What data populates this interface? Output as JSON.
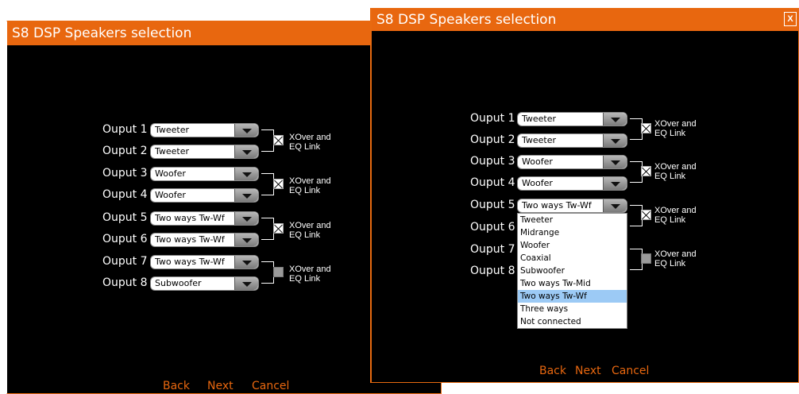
{
  "left_window": {
    "title": "S8 DSP Speakers selection",
    "outputs": [
      {
        "label": "Ouput 1",
        "value": "Tweeter"
      },
      {
        "label": "Ouput 2",
        "value": "Tweeter"
      },
      {
        "label": "Ouput 3",
        "value": "Woofer"
      },
      {
        "label": "Ouput 4",
        "value": "Woofer"
      },
      {
        "label": "Ouput 5",
        "value": "Two ways Tw-Wf"
      },
      {
        "label": "Ouput 6",
        "value": "Two ways Tw-Wf"
      },
      {
        "label": "Ouput 7",
        "value": "Two ways Tw-Wf"
      },
      {
        "label": "Ouput 8",
        "value": "Subwoofer"
      }
    ],
    "links": [
      {
        "line1": "XOver and",
        "line2": "EQ Link",
        "state": "checked"
      },
      {
        "line1": "XOver and",
        "line2": "EQ Link",
        "state": "checked"
      },
      {
        "line1": "XOver and",
        "line2": "EQ Link",
        "state": "checked"
      },
      {
        "line1": "XOver and",
        "line2": "EQ Link",
        "state": "disabled"
      }
    ],
    "footer": {
      "back": "Back",
      "next": "Next",
      "cancel": "Cancel"
    }
  },
  "right_window": {
    "title": "S8 DSP Speakers selection",
    "close_label": "X",
    "outputs": [
      {
        "label": "Ouput 1",
        "value": "Tweeter"
      },
      {
        "label": "Ouput 2",
        "value": "Tweeter"
      },
      {
        "label": "Ouput 3",
        "value": "Woofer"
      },
      {
        "label": "Ouput 4",
        "value": "Woofer"
      },
      {
        "label": "Ouput 5",
        "value": "Two ways Tw-Wf"
      },
      {
        "label": "Ouput 6",
        "value": ""
      },
      {
        "label": "Ouput 7",
        "value": ""
      },
      {
        "label": "Ouput 8",
        "value": ""
      }
    ],
    "links": [
      {
        "line1": "XOver and",
        "line2": "EQ Link",
        "state": "checked"
      },
      {
        "line1": "XOver and",
        "line2": "EQ Link",
        "state": "checked"
      },
      {
        "line1": "XOver and",
        "line2": "EQ Link",
        "state": "checked"
      },
      {
        "line1": "XOver and",
        "line2": "EQ Link",
        "state": "disabled"
      }
    ],
    "dropdown": {
      "options": [
        "Tweeter",
        "Midrange",
        "Woofer",
        "Coaxial",
        "Subwoofer",
        "Two ways Tw-Mid",
        "Two ways Tw-Wf",
        "Three ways",
        "Not connected"
      ],
      "selected": "Two ways Tw-Wf"
    },
    "footer": {
      "back": "Back",
      "next": "Next",
      "cancel": "Cancel"
    }
  }
}
